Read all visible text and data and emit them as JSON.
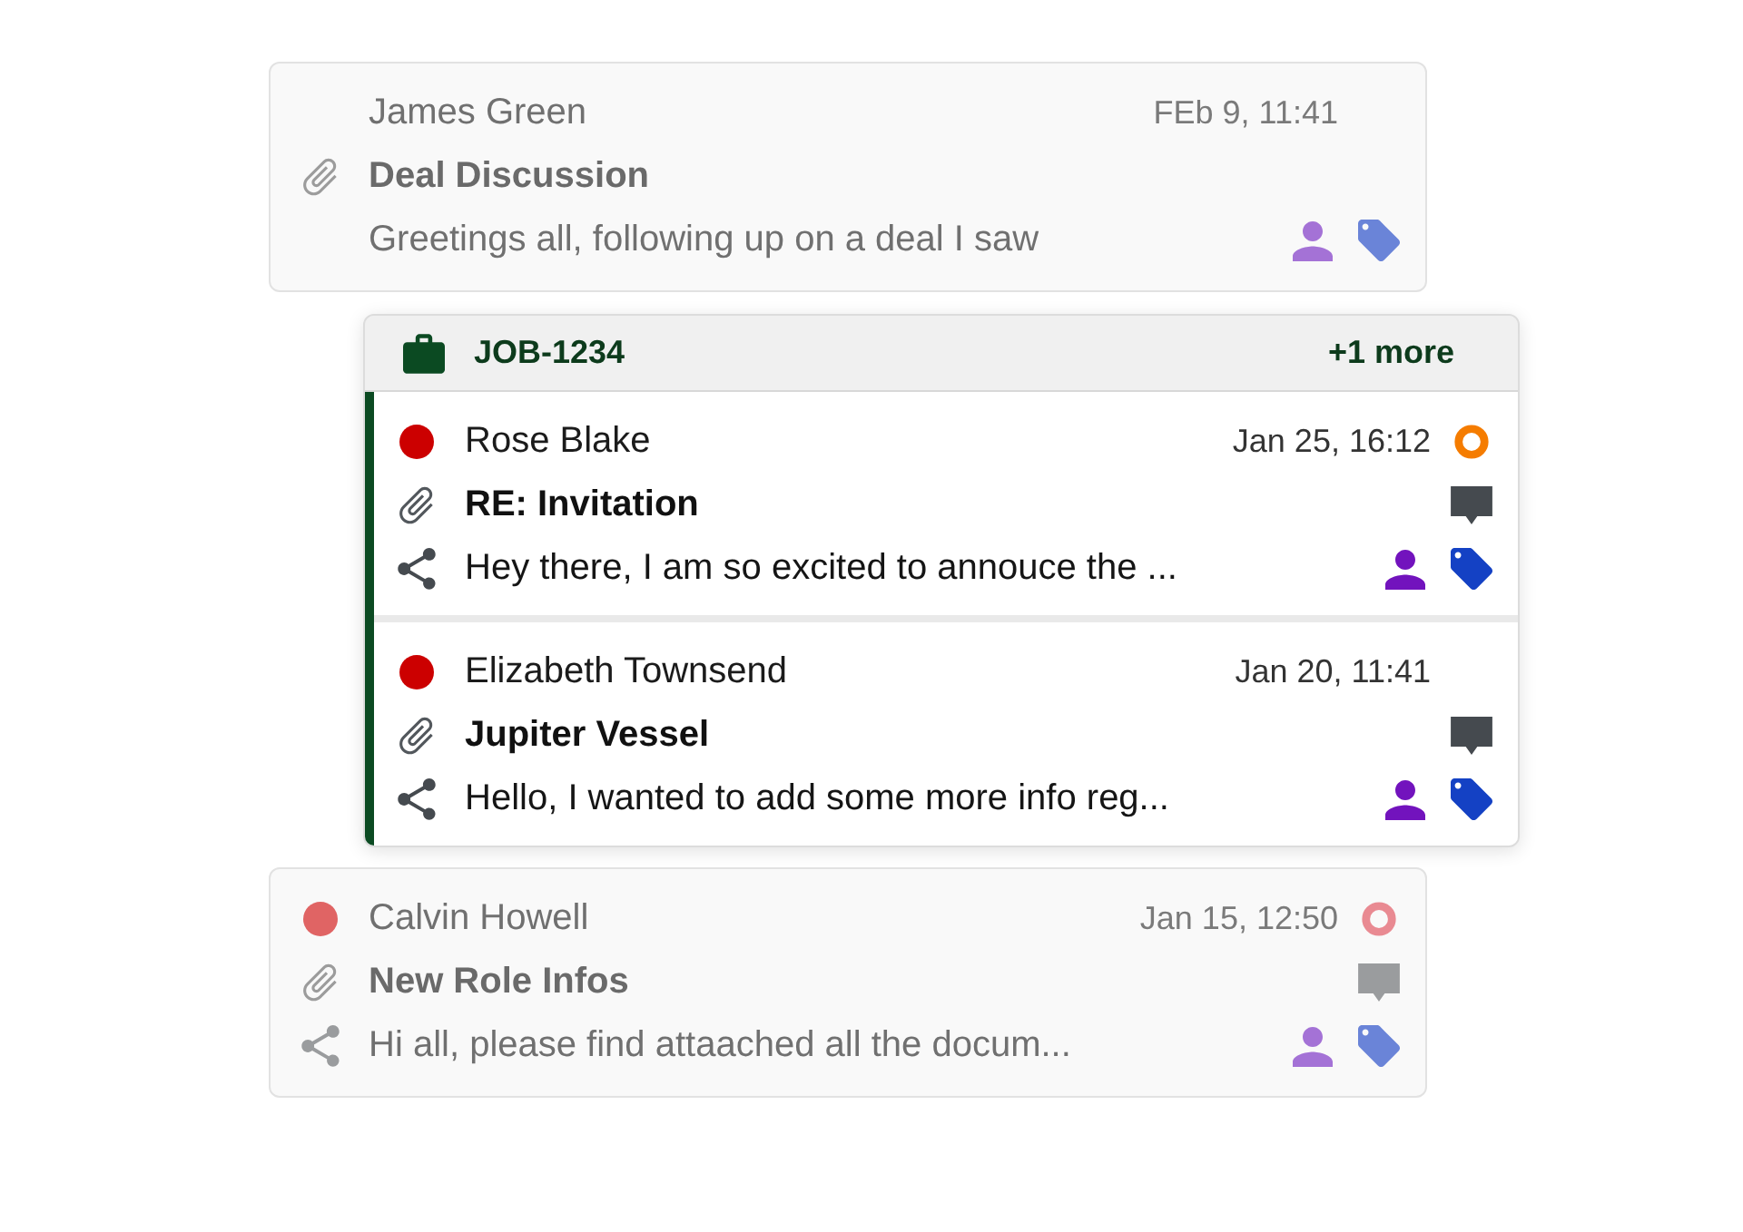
{
  "items": [
    {
      "kind": "message",
      "dimmed": true,
      "unread": false,
      "sender": "James Green",
      "date": "FEb 9, 11:41",
      "attachment": true,
      "subject": "Deal Discussion",
      "comments": false,
      "shared": false,
      "preview": "Greetings all, following up on a deal I saw",
      "assigned": true,
      "tagged": true
    },
    {
      "kind": "group",
      "label": "JOB-1234",
      "more": "+1 more",
      "messages": [
        {
          "dimmed": false,
          "unread": true,
          "sender": "Rose Blake",
          "date": "Jan 25, 16:12",
          "status": {
            "color": "#f57c00"
          },
          "attachment": true,
          "subject": "RE: Invitation",
          "comments": true,
          "shared": true,
          "preview": "Hey there, I am so excited to annouce the ...",
          "assigned": true,
          "tagged": true
        },
        {
          "dimmed": false,
          "unread": true,
          "sender": "Elizabeth Townsend",
          "date": "Jan 20, 11:41",
          "attachment": true,
          "subject": "Jupiter Vessel",
          "comments": true,
          "shared": true,
          "preview": "Hello, I wanted to add some more info reg...",
          "assigned": true,
          "tagged": true
        }
      ]
    },
    {
      "kind": "message",
      "dimmed": true,
      "unread": true,
      "sender": "Calvin Howell",
      "date": "Jan 15, 12:50",
      "status": {
        "color": "#e98a92"
      },
      "attachment": true,
      "subject": "New Role Infos",
      "comments": true,
      "shared": true,
      "preview": "Hi all, please find attaached all the docum...",
      "assigned": true,
      "tagged": true
    }
  ]
}
